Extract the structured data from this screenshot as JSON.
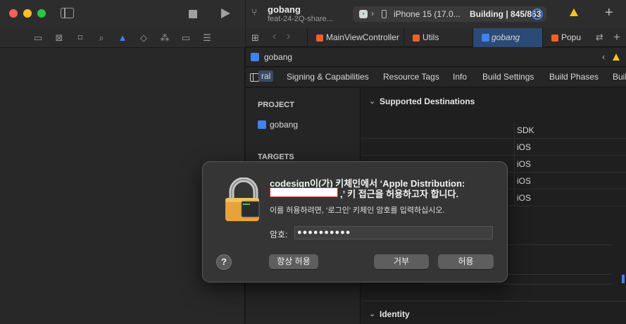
{
  "toolbar": {
    "project": "gobang",
    "branch": "feat-24-2Q-share...",
    "device": "iPhone 15 (17.0...",
    "status": "Building | 845/863"
  },
  "tabs": [
    "MainViewController",
    "Utils",
    "gobang",
    "Popu"
  ],
  "jumpbar": {
    "label": "gobang"
  },
  "settings_tabs": [
    "ral",
    "Signing & Capabilities",
    "Resource Tags",
    "Info",
    "Build Settings",
    "Build Phases",
    "Buil"
  ],
  "sidebar": {
    "project_header": "PROJECT",
    "project_item": "gobang",
    "targets_header": "TARGETS"
  },
  "content": {
    "supported_destinations": "Supported Destinations",
    "sdk_header": "SDK",
    "sdk_rows": [
      "iOS",
      "iOS",
      "iOS",
      "iOS"
    ],
    "identity": "Identity"
  },
  "dialog": {
    "title_line1": "codesign이(가) 키체인에서 ‘Apple Distribution:",
    "title_line2": ",’ 키 접근을 허용하고자 합니다.",
    "message": "이를 허용하려면, ‘로그인’ 키체인 암호를 입력하십시오.",
    "password_label": "암호:",
    "password_value": "●●●●●●●●●●",
    "help_label": "?",
    "always_allow": "항상 허용",
    "deny": "거부",
    "allow": "허용"
  },
  "colors": {
    "accent": "#3f82f0",
    "warning": "#f5c518",
    "active_tab": "#2b4a74"
  }
}
